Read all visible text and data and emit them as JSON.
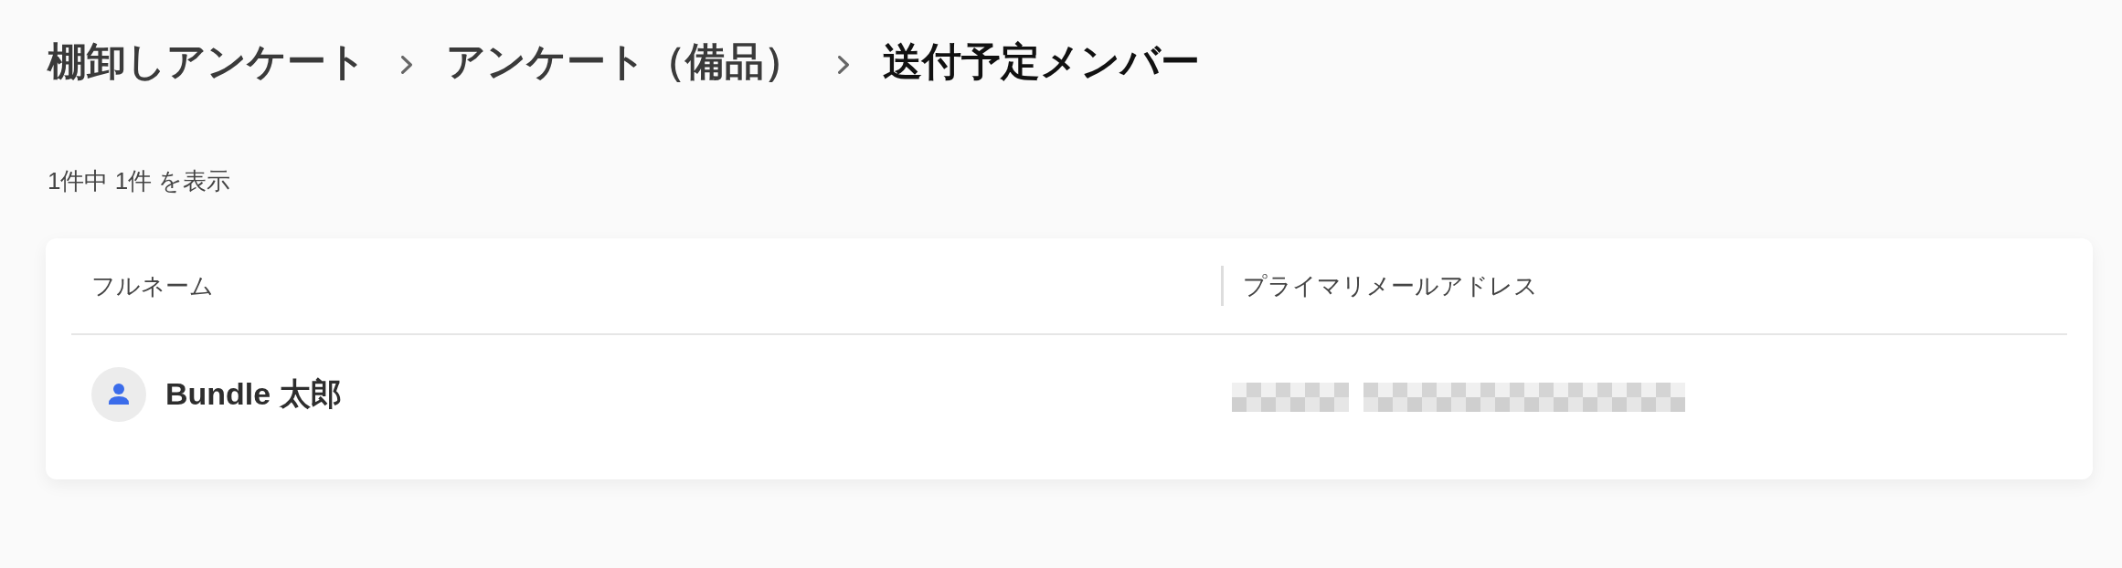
{
  "breadcrumb": [
    {
      "label": "棚卸しアンケート",
      "current": false
    },
    {
      "label": "アンケート（備品）",
      "current": false
    },
    {
      "label": "送付予定メンバー",
      "current": true
    }
  ],
  "result_count": "1件中 1件 を表示",
  "table": {
    "columns": [
      "フルネーム",
      "プライマリメールアドレス"
    ],
    "rows": [
      {
        "full_name": "Bundle 太郎",
        "email_redacted": true
      }
    ]
  }
}
